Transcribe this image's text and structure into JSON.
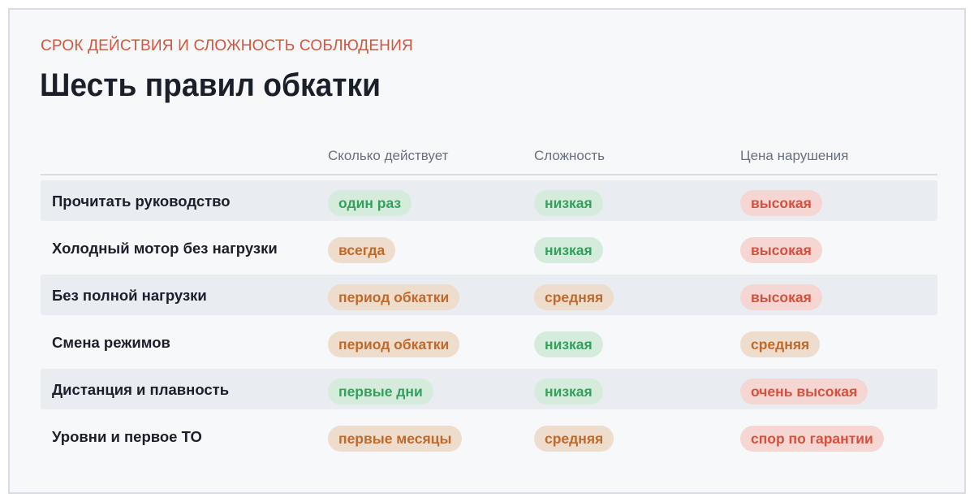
{
  "header": {
    "eyebrow": "СРОК ДЕЙСТВИЯ И СЛОЖНОСТЬ СОБЛЮДЕНИЯ",
    "title": "Шесть правил обкатки"
  },
  "table": {
    "columns": [
      "",
      "Сколько действует",
      "Сложность",
      "Цена нарушения"
    ],
    "rows": [
      {
        "rule": "Прочитать руководство",
        "duration": "один раз",
        "duration_tone": "green",
        "difficulty": "низкая",
        "difficulty_tone": "green",
        "cost": "высокая",
        "cost_tone": "red"
      },
      {
        "rule": "Холодный мотор без нагрузки",
        "duration": "всегда",
        "duration_tone": "orange",
        "difficulty": "низкая",
        "difficulty_tone": "green",
        "cost": "высокая",
        "cost_tone": "red"
      },
      {
        "rule": "Без полной нагрузки",
        "duration": "период обкатки",
        "duration_tone": "orange",
        "difficulty": "средняя",
        "difficulty_tone": "orange",
        "cost": "высокая",
        "cost_tone": "red"
      },
      {
        "rule": "Смена режимов",
        "duration": "период обкатки",
        "duration_tone": "orange",
        "difficulty": "низкая",
        "difficulty_tone": "green",
        "cost": "средняя",
        "cost_tone": "orange"
      },
      {
        "rule": "Дистанция и плавность",
        "duration": "первые дни",
        "duration_tone": "green",
        "difficulty": "низкая",
        "difficulty_tone": "green",
        "cost": "очень высокая",
        "cost_tone": "red"
      },
      {
        "rule": "Уровни и первое ТО",
        "duration": "первые месяцы",
        "duration_tone": "orange",
        "difficulty": "средняя",
        "difficulty_tone": "orange",
        "cost": "спор по гарантии",
        "cost_tone": "red"
      }
    ]
  },
  "colors": {
    "green_text": "#35a05c",
    "green_bg": "#d5ecdd",
    "orange_text": "#be6a2d",
    "orange_bg": "#eedccc",
    "red_text": "#d5503d",
    "red_bg": "#f5d6d3",
    "eyebrow": "#d2553d"
  }
}
